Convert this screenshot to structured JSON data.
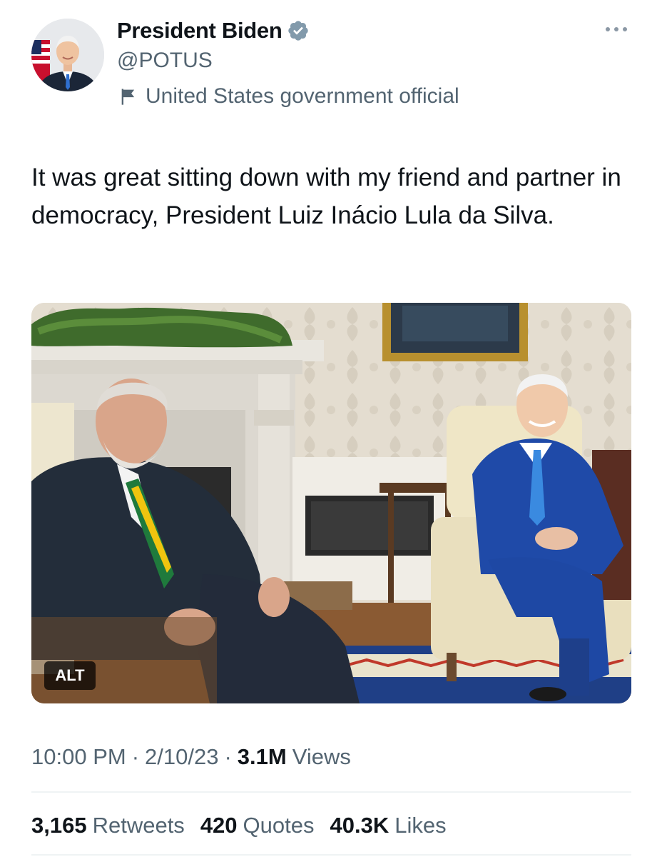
{
  "author": {
    "display_name": "President Biden",
    "handle": "@POTUS",
    "label": "United States government official",
    "verified_color": "#829aab"
  },
  "tweet": {
    "text": "It was great sitting down with my friend and partner in democracy, President Luiz Inácio Lula da Silva.",
    "media_alt_badge": "ALT",
    "time": "10:00 PM",
    "date": "2/10/23",
    "views_count": "3.1M",
    "views_label": "Views",
    "meta_separator": "·"
  },
  "stats": {
    "retweets_count": "3,165",
    "retweets_label": "Retweets",
    "quotes_count": "420",
    "quotes_label": "Quotes",
    "likes_count": "40.3K",
    "likes_label": "Likes"
  },
  "icons": {
    "verified": "verified-badge-icon",
    "flag": "flag-icon",
    "more": "more-horizontal-icon"
  },
  "colors": {
    "text_primary": "#0f1419",
    "text_secondary": "#536471",
    "divider": "#eff3f4"
  }
}
